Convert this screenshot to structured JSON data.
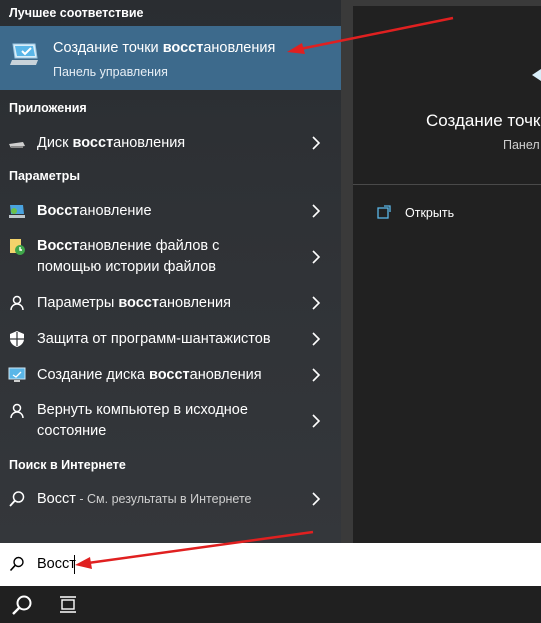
{
  "sections": {
    "best_match": "Лучшее соответствие",
    "apps": "Приложения",
    "settings": "Параметры",
    "web": "Поиск в Интернете"
  },
  "best_match": {
    "title_pre": "Создание точки ",
    "title_bold": "восст",
    "title_post": "ановления",
    "subtitle": "Панель управления"
  },
  "apps": [
    {
      "pre": "Диск ",
      "bold": "восст",
      "post": "ановления",
      "icon": "drive-icon"
    }
  ],
  "settings": [
    {
      "line1_pre": "",
      "line1_bold": "Восст",
      "line1_post": "ановление",
      "icon": "recovery-icon"
    },
    {
      "line1_pre": "",
      "line1_bold": "Восст",
      "line1_post": "ановление файлов с",
      "line2": "помощью истории файлов",
      "icon": "file-history-icon"
    },
    {
      "line1_pre": "Параметры ",
      "line1_bold": "восст",
      "line1_post": "ановления",
      "icon": "recovery-settings-icon"
    },
    {
      "line1_pre": "Защита от программ-шантажистов",
      "line1_bold": "",
      "line1_post": "",
      "icon": "shield-icon"
    },
    {
      "line1_pre": "Создание диска ",
      "line1_bold": "восст",
      "line1_post": "ановления",
      "icon": "monitor-icon"
    },
    {
      "line1_pre": "Вернуть компьютер в исходное",
      "line1_bold": "",
      "line1_post": "",
      "line2": "состояние",
      "icon": "reset-icon"
    }
  ],
  "web": {
    "query": "Восст",
    "suffix": " - См. результаты в Интернете"
  },
  "preview": {
    "title": "Создание точк",
    "subtitle": "Панел",
    "open": "Открыть"
  },
  "search": {
    "value": "Восст"
  },
  "colors": {
    "highlight": "#3d6a8c",
    "arrow": "#e02020"
  }
}
